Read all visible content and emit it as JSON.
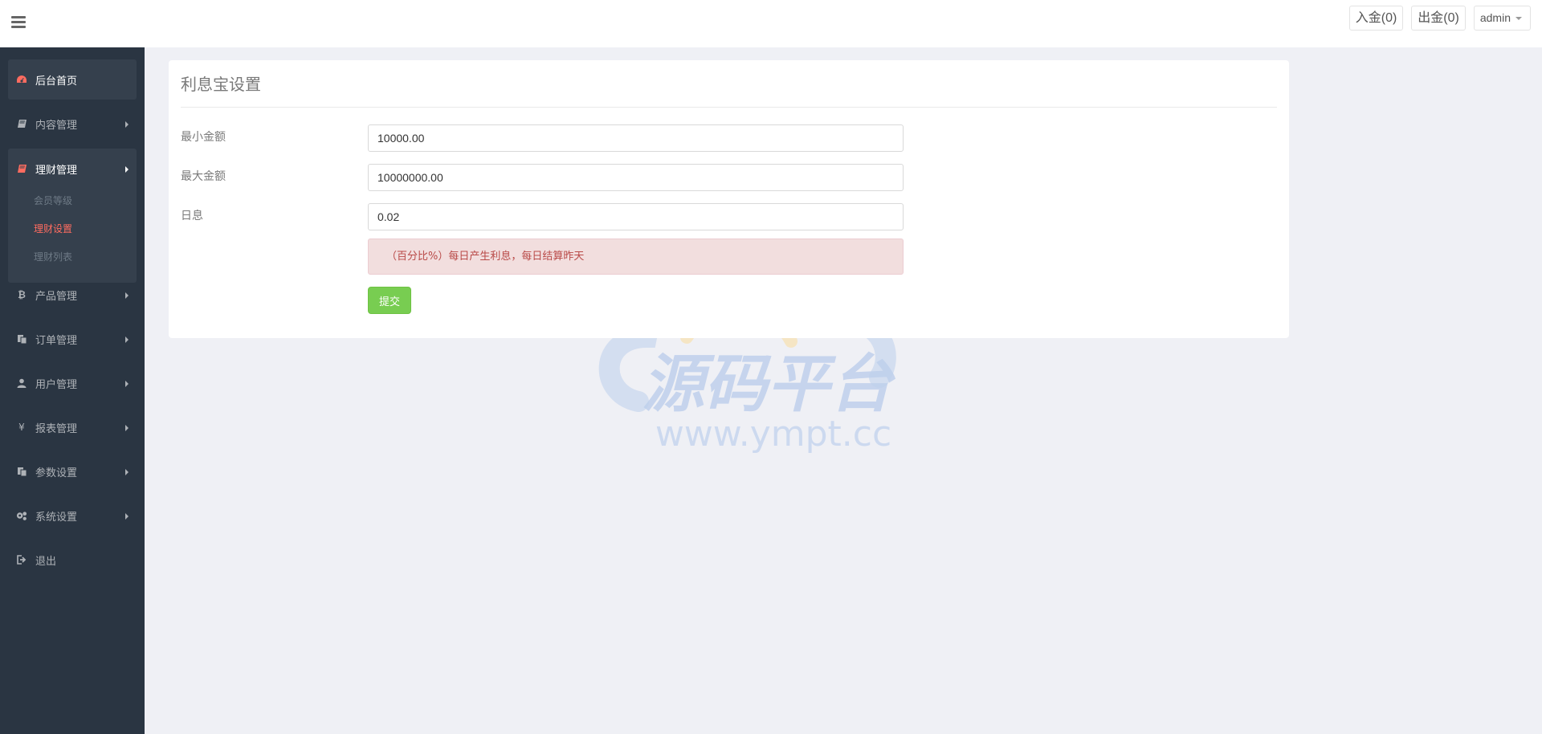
{
  "header": {
    "deposit_label": "入金(0)",
    "withdraw_label": "出金(0)",
    "user_label": "admin"
  },
  "sidebar": {
    "items": [
      {
        "label": "后台首页",
        "icon": "dashboard-icon"
      },
      {
        "label": "内容管理",
        "icon": "book-icon"
      },
      {
        "label": "理财管理",
        "icon": "book-icon"
      },
      {
        "label": "产品管理",
        "icon": "bitcoin-icon"
      },
      {
        "label": "订单管理",
        "icon": "files-icon"
      },
      {
        "label": "用户管理",
        "icon": "user-icon"
      },
      {
        "label": "报表管理",
        "icon": "yen-icon"
      },
      {
        "label": "参数设置",
        "icon": "files-icon"
      },
      {
        "label": "系统设置",
        "icon": "gears-icon"
      },
      {
        "label": "退出",
        "icon": "sign-out-icon"
      }
    ],
    "submenu": [
      {
        "label": "会员等级"
      },
      {
        "label": "理财设置"
      },
      {
        "label": "理财列表"
      }
    ]
  },
  "panel": {
    "title": "利息宝设置",
    "fields": [
      {
        "label": "最小金额",
        "value": "10000.00"
      },
      {
        "label": "最大金额",
        "value": "10000000.00"
      },
      {
        "label": "日息",
        "value": "0.02"
      }
    ],
    "hint": "（百分比%）每日产生利息，每日结算昨天",
    "submit_label": "提交"
  },
  "watermark": {
    "title": "源码平台",
    "url": "www.ympt.cc"
  },
  "colors": {
    "sidebar_bg": "#2a3542",
    "accent_red": "#ff6c60",
    "submit_green": "#78cd51",
    "alert_bg": "#f2dede",
    "alert_text": "#b94a48"
  }
}
